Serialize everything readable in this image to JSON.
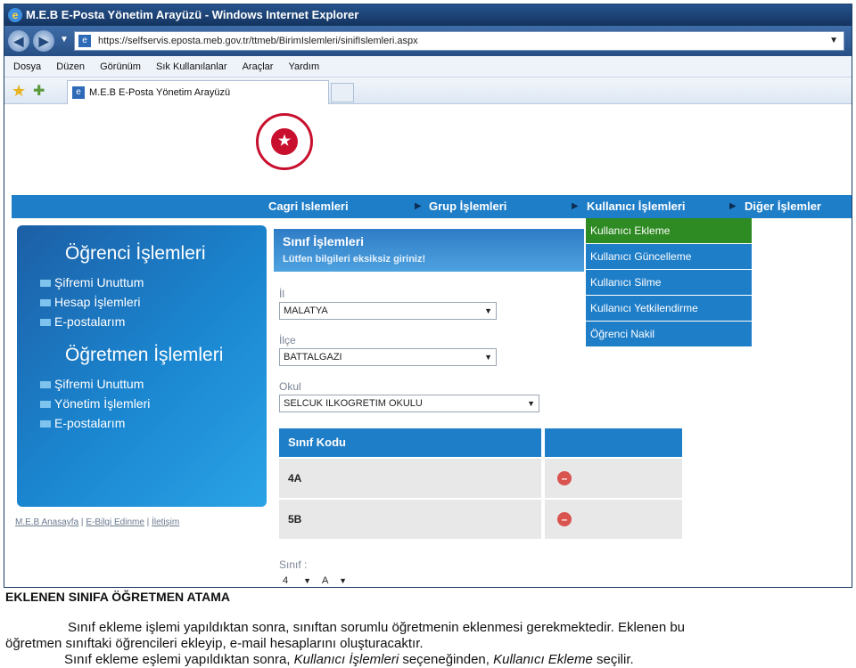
{
  "window": {
    "title": "M.E.B E-Posta Yönetim Arayüzü - Windows Internet Explorer",
    "url": "https://selfservis.eposta.meb.gov.tr/ttmeb/BirimIslemleri/sinifIslemleri.aspx"
  },
  "menubar": [
    "Dosya",
    "Düzen",
    "Görünüm",
    "Sık Kullanılanlar",
    "Araçlar",
    "Yardım"
  ],
  "tab": {
    "label": "M.E.B E-Posta Yönetim Arayüzü"
  },
  "nav": {
    "items": [
      "Cagri Islemleri",
      "Grup İşlemleri",
      "Kullanıcı İşlemleri",
      "Diğer İşlemler"
    ]
  },
  "sidebar": {
    "student_head": "Öğrenci İşlemleri",
    "student_items": [
      "Şifremi Unuttum",
      "Hesap İşlemleri",
      "E-postalarım"
    ],
    "teacher_head": "Öğretmen İşlemleri",
    "teacher_items": [
      "Şifremi Unuttum",
      "Yönetim İşlemleri",
      "E-postalarım"
    ]
  },
  "footer_links": [
    "M.E.B Anasayfa",
    "E-Bilgi Edinme",
    "İletişim"
  ],
  "panel": {
    "title": "Sınıf İşlemleri",
    "subtitle": "Lütfen bilgileri eksiksiz giriniz!"
  },
  "form": {
    "il_label": "İl",
    "il_value": "MALATYA",
    "ilce_label": "İlçe",
    "ilce_value": "BATTALGAZI",
    "okul_label": "Okul",
    "okul_value": "SELCUK ILKOGRETIM OKULU",
    "sinif_label": "Sınıf :",
    "sinif_grade": "4",
    "sinif_section": "A"
  },
  "user_menu": [
    "Kullanıcı Ekleme",
    "Kullanıcı Güncelleme",
    "Kullanıcı Silme",
    "Kullanıcı Yetkilendirme",
    "Öğrenci Nakil"
  ],
  "table": {
    "header": "Sınıf Kodu",
    "rows": [
      "4A",
      "5B"
    ]
  },
  "caption": {
    "title": "EKLENEN SINIFA ÖĞRETMEN ATAMA",
    "para1": "Sınıf ekleme işlemi yapıldıktan sonra, sınıftan sorumlu öğretmenin eklenmesi gerekmektedir. Eklenen bu",
    "para2": "öğretmen sınıftaki öğrencileri ekleyip, e-mail hesaplarını oluşturacaktır.",
    "para3a": "Sınıf ekleme eşlemi yapıldıktan sonra, ",
    "para3b": "Kullanıcı İşlemleri",
    "para3c": " seçeneğinden, ",
    "para3d": "Kullanıcı Ekleme",
    "para3e": " seçilir."
  },
  "colors": {
    "nav_blue": "#1f7ec8",
    "active_green": "#2e8a22",
    "titlebar": "#26538d"
  }
}
